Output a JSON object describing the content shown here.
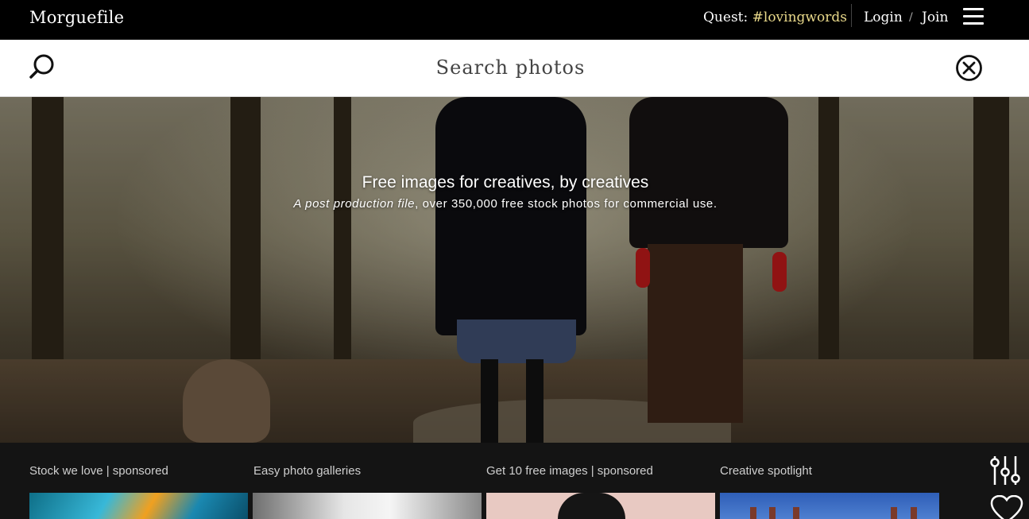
{
  "header": {
    "logo": "Morguefile",
    "quest_label": "Quest:",
    "quest_tag": "#lovingwords",
    "login_label": "Login",
    "separator": "/",
    "join_label": "Join",
    "menu_icon": "hamburger-icon"
  },
  "search": {
    "placeholder": "Search photos",
    "search_icon": "search-icon",
    "clear_icon": "close-circle-icon"
  },
  "hero": {
    "title": "Free images for creatives, by creatives",
    "subtitle_italic": "A post production file",
    "subtitle_rest": ", over 350,000 free stock photos for commercial use."
  },
  "sections": [
    {
      "label": "Stock we love | sponsored"
    },
    {
      "label": "Easy photo galleries"
    },
    {
      "label": "Get 10 free images | sponsored"
    },
    {
      "label": "Creative spotlight"
    }
  ],
  "side_tools": {
    "filter_icon": "sliders-icon",
    "favorite_icon": "heart-icon"
  },
  "colors": {
    "topbar_bg": "#000000",
    "quest_tag": "#e9d98a",
    "lower_bg": "#141414"
  }
}
